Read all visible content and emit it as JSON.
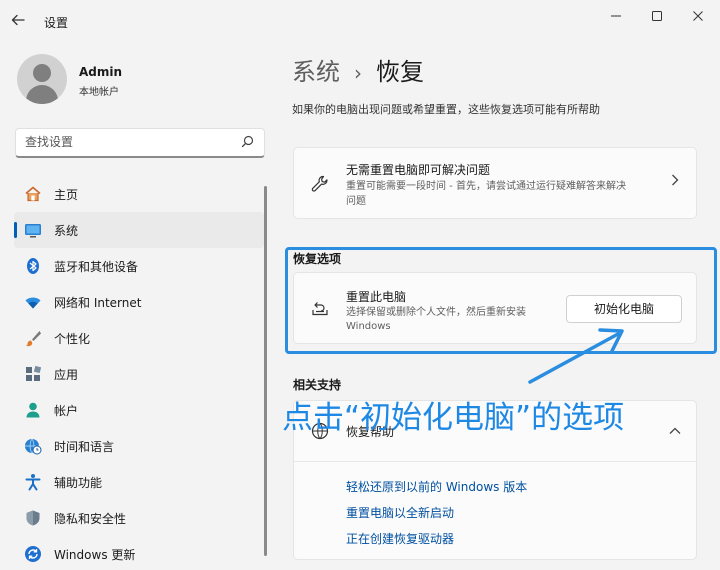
{
  "app": {
    "title": "设置"
  },
  "window": {
    "minimize": "—",
    "maximize": "☐",
    "close": "✕"
  },
  "user": {
    "name": "Admin",
    "account_type": "本地帐户"
  },
  "search": {
    "placeholder": "查找设置"
  },
  "sidebar": {
    "items": [
      {
        "label": "主页",
        "icon": "home-icon"
      },
      {
        "label": "系统",
        "icon": "system-icon",
        "selected": true
      },
      {
        "label": "蓝牙和其他设备",
        "icon": "bluetooth-icon"
      },
      {
        "label": "网络和 Internet",
        "icon": "wifi-icon"
      },
      {
        "label": "个性化",
        "icon": "brush-icon"
      },
      {
        "label": "应用",
        "icon": "apps-icon"
      },
      {
        "label": "帐户",
        "icon": "account-icon"
      },
      {
        "label": "时间和语言",
        "icon": "globe-clock-icon"
      },
      {
        "label": "辅助功能",
        "icon": "accessibility-icon"
      },
      {
        "label": "隐私和安全性",
        "icon": "shield-icon"
      },
      {
        "label": "Windows 更新",
        "icon": "update-icon"
      }
    ]
  },
  "main": {
    "breadcrumb_parent": "系统",
    "breadcrumb_separator": "›",
    "breadcrumb_current": "恢复",
    "description": "如果你的电脑出现问题或希望重置，这些恢复选项可能有所帮助",
    "fix_card": {
      "title": "无需重置电脑即可解决问题",
      "desc_line1": "重置可能需要一段时间 - 首先，请尝试通过运行疑难解答来解决",
      "desc_line2": "问题"
    },
    "recovery_options": {
      "heading": "恢复选项",
      "reset_title": "重置此电脑",
      "reset_desc_line1": "选择保留或删除个人文件，然后重新安装",
      "reset_desc_line2": "Windows",
      "reset_button": "初始化电脑"
    },
    "related_support": {
      "heading": "相关支持",
      "help_title": "恢复帮助",
      "links": [
        "轻松还原到以前的 Windows 版本",
        "重置电脑以全新启动",
        "正在创建恢复驱动器"
      ]
    }
  },
  "annotation": {
    "text": "点击“初始化电脑”的选项"
  },
  "colors": {
    "accent": "#005fb8",
    "highlight": "#2a8de0",
    "annotation": "#1e88e5",
    "link": "#0050a0"
  }
}
